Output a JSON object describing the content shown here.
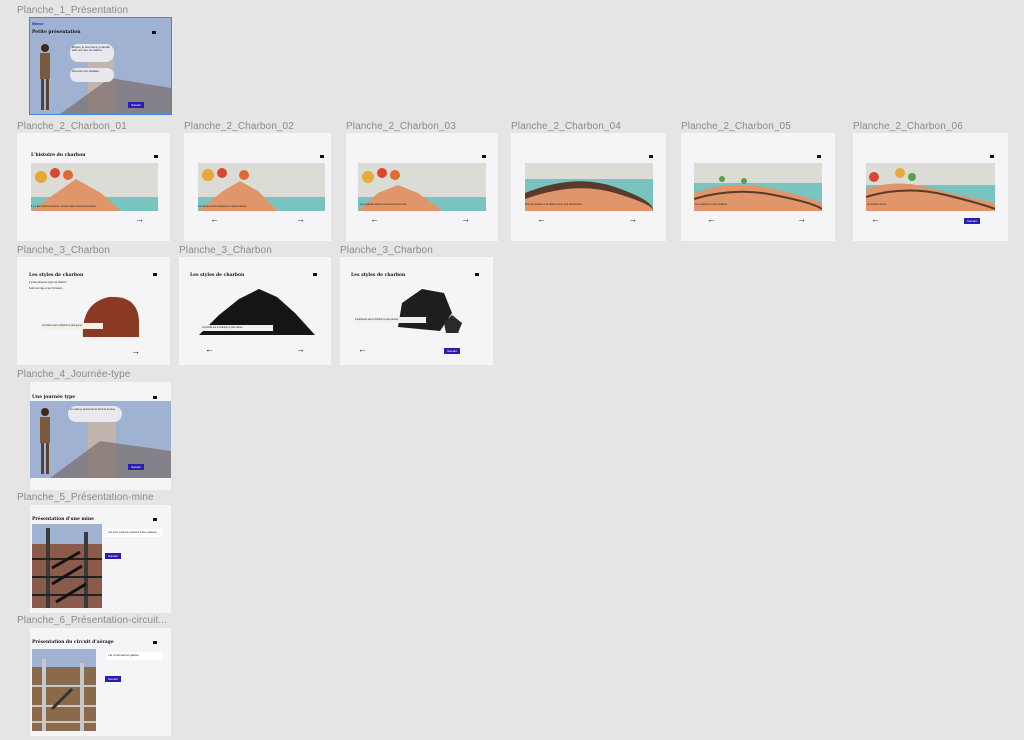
{
  "frames": {
    "f1": {
      "label": "Planche_1_Présentation",
      "heading_small": "Mineur",
      "title": "Petite présentation",
      "bubble1": "Bonjour, je suis mineur, je travaille dans une mine de charbon.",
      "bubble2": "Découvre mon quotidien.",
      "button": "Suivant"
    },
    "f2": {
      "label": "Planche_2_Charbon_01",
      "title": "L'histoire du charbon",
      "text": "Il y a des millions d'années, la Terre était recouverte de forêts."
    },
    "f3": {
      "label": "Planche_2_Charbon_02",
      "text": "Les arbres morts tombaient et s'accumulaient."
    },
    "f4": {
      "label": "Planche_2_Charbon_03",
      "text": "Les végétaux étaient recouverts par la boue."
    },
    "f5": {
      "label": "Planche_2_Charbon_04",
      "text": "Sous la pression et la chaleur, ils se sont transformés."
    },
    "f6": {
      "label": "Planche_2_Charbon_05",
      "text": "Les couches se sont empilées."
    },
    "f7": {
      "label": "Planche_2_Charbon_06",
      "text": "Le charbon est né.",
      "button": "Suivant"
    },
    "f8": {
      "label": "Planche_3_Charbon",
      "title": "Les styles de charbon",
      "line1": "Il existe plusieurs types de charbon.",
      "line2": "Selon leur âge et leur formation.",
      "text": "La tourbe est le charbon le plus jeune."
    },
    "f9": {
      "label": "Planche_3_Charbon",
      "title": "Les styles de charbon",
      "text": "La houille est le charbon le plus utilisé."
    },
    "f10": {
      "label": "Planche_3_Charbon",
      "title": "Les styles de charbon",
      "text": "L'anthracite est le charbon le plus ancien.",
      "button": "Suivant"
    },
    "f11": {
      "label": "Planche_4_Journée-type",
      "title": "Une journée type",
      "bubble": "Le matin je descends au fond de la mine.",
      "button": "Suivant"
    },
    "f12": {
      "label": "Planche_5_Présentation-mine",
      "title": "Présentation d'une mine",
      "text": "Une mine comporte plusieurs puits et galeries.",
      "button": "Suivant"
    },
    "f13": {
      "label": "Planche_6_Présentation-circuit...",
      "title": "Présentation du circuit d'aérage",
      "text": "L'air circule dans les galeries.",
      "button": "Suivant"
    }
  },
  "icons": {
    "arrow_right": "→",
    "arrow_left": "←"
  }
}
